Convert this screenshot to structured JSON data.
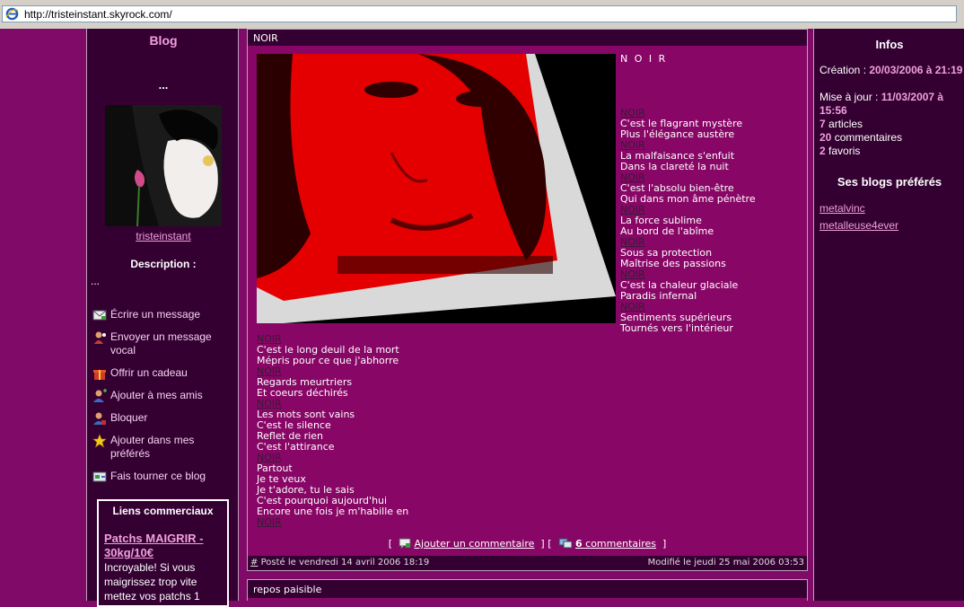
{
  "browser": {
    "url": "http://tristeinstant.skyrock.com/"
  },
  "sidebar": {
    "title": "Blog",
    "dots": "...",
    "username": "tristeinstant",
    "description_label": "Description :",
    "description_value": "...",
    "actions": [
      {
        "label": "Écrire un message",
        "icon": "envelope-icon"
      },
      {
        "label": "Envoyer un message vocal",
        "icon": "voice-message-icon"
      },
      {
        "label": "Offrir un cadeau",
        "icon": "gift-icon"
      },
      {
        "label": "Ajouter à mes amis",
        "icon": "add-friend-icon"
      },
      {
        "label": "Bloquer",
        "icon": "block-user-icon"
      },
      {
        "label": "Ajouter dans mes préférés",
        "icon": "star-icon"
      },
      {
        "label": "Fais tourner ce blog",
        "icon": "share-blog-icon"
      }
    ],
    "commercial": {
      "heading": "Liens commerciaux",
      "link": "Patchs MAIGRIR - 30kg/10€",
      "text": "Incroyable! Si vous maigrissez trop vite mettez vos patchs 1"
    }
  },
  "article": {
    "title": "NOIR",
    "poem_intro": "N O I R",
    "poem_right": [
      "NOIR",
      "C'est le flagrant mystère",
      "Plus l'élégance austère",
      "NOIR",
      "La malfaisance s'enfuit",
      "Dans la clareté la nuit",
      "NOIR",
      "C'est l'absolu bien-être",
      "Qui dans mon âme pénètre",
      "NOIR",
      "La force sublime",
      "Au bord de l'abîme",
      "NOIR",
      "Sous sa protection",
      "Maîtrise des passions",
      "NOIR",
      "C'est la chaleur glaciale",
      "Paradis infernal",
      "NOIR",
      "Sentiments supérieurs",
      "Tournés vers l'intérieur"
    ],
    "poem_bottom": [
      "NOIR",
      "C'est le long deuil de la mort",
      "Mépris pour ce que j'abhorre",
      "NOIR",
      "Regards meurtriers",
      "Et coeurs déchirés",
      "NOIR",
      "Les mots sont vains",
      "C'est le silence",
      "Reflet de rien",
      "C'est l'attirance",
      "NOIR",
      "Partout",
      "Je te veux",
      "Je t'adore, tu le sais",
      "C'est pourquoi aujourd'hui",
      "Encore une fois je m'habille en",
      "NOIR"
    ],
    "add_comment": "Ajouter un commentaire",
    "comments_count": "6",
    "comments_word": "commentaires",
    "posted": "Posté le vendredi 14 avril 2006 18:19",
    "modified": "Modifié le jeudi 25 mai 2006 03:53",
    "permalink": "#"
  },
  "next_article": {
    "title": "repos paisible"
  },
  "infos": {
    "title": "Infos",
    "creation_label": "Création : ",
    "creation_value": "20/03/2006 à 21:19",
    "update_label": "Mise à jour : ",
    "update_value": "11/03/2007 à 15:56",
    "articles_count": "7",
    "articles_label": " articles",
    "comments_count": "20",
    "comments_label": " commentaires",
    "favorites_count": "2",
    "favorites_label": " favoris",
    "fav_title": "Ses blogs préférés",
    "fav_blogs": [
      "metalvinc",
      "metalleuse4ever"
    ]
  }
}
